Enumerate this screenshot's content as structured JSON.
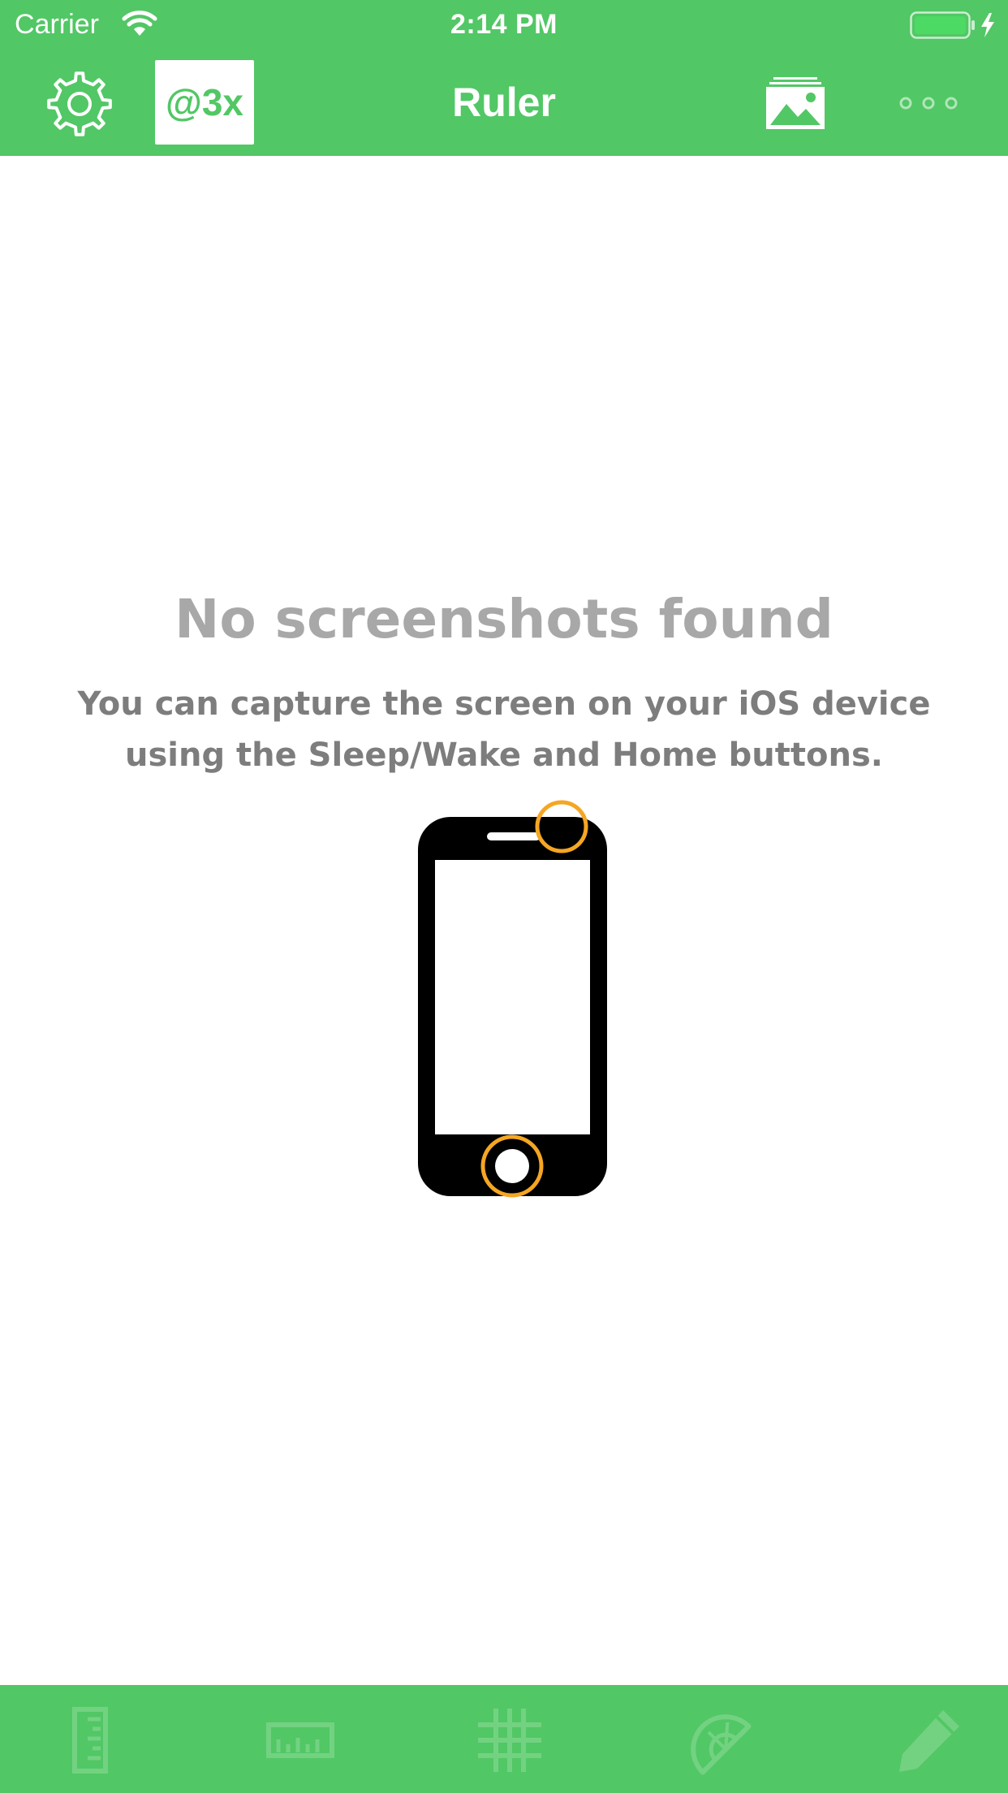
{
  "status_bar": {
    "carrier": "Carrier",
    "time": "2:14 PM",
    "wifi_icon": "wifi-icon",
    "battery_icon": "battery-charging-icon"
  },
  "nav_bar": {
    "title": "Ruler",
    "scale_label": "@3x",
    "settings_icon": "gear-icon",
    "gallery_icon": "photo-library-icon",
    "more_icon": "ellipsis-icon"
  },
  "empty_state": {
    "title": "No screenshots found",
    "message": "You can capture the screen on your iOS device using the Sleep/Wake and Home buttons.",
    "illustration_icon": "phone-buttons-icon"
  },
  "tab_bar": {
    "tabs": [
      {
        "icon": "vertical-ruler-icon"
      },
      {
        "icon": "horizontal-ruler-icon"
      },
      {
        "icon": "grid-icon"
      },
      {
        "icon": "protractor-icon"
      },
      {
        "icon": "pencil-icon"
      }
    ]
  },
  "colors": {
    "accent": "#52c765",
    "tab_icon": "#73d282",
    "title_text": "#a8a8a8",
    "message_text": "#7d7d7d",
    "highlight": "#f5a623",
    "device": "#000000"
  }
}
